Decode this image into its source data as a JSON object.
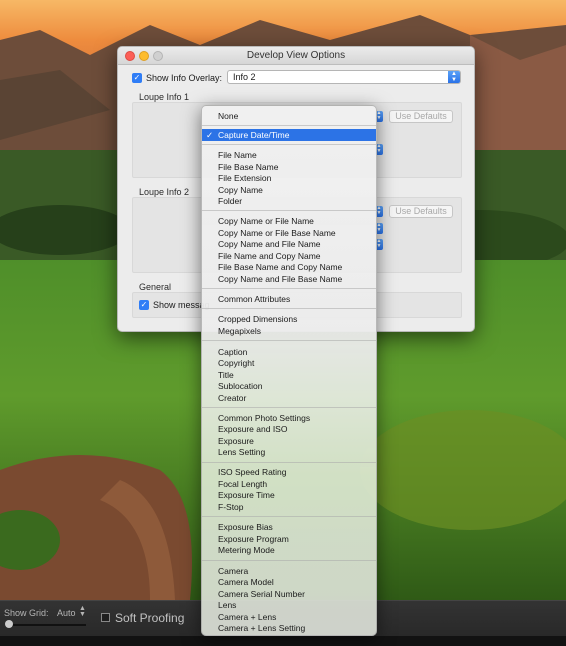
{
  "dialog": {
    "title": "Develop View Options",
    "show_info_overlay_label": "Show Info Overlay:",
    "show_info_overlay_checked": true,
    "overlay_value": "Info 2",
    "loupe_info_1_label": "Loupe Info 1",
    "loupe_info_2_label": "Loupe Info 2",
    "general_label": "General",
    "use_defaults_label": "Use Defaults",
    "show_messages_label": "Show messag",
    "show_messages_checked": true
  },
  "menu": {
    "selected": "Capture Date/Time",
    "check_mark": "✓",
    "items": [
      "None",
      "Capture Date/Time",
      "File Name",
      "File Base Name",
      "File Extension",
      "Copy Name",
      "Folder",
      "Copy Name or File Name",
      "Copy Name or File Base Name",
      "Copy Name and File Name",
      "File Name and Copy Name",
      "File Base Name and Copy Name",
      "Copy Name and File Base Name",
      "Common Attributes",
      "Cropped Dimensions",
      "Megapixels",
      "Caption",
      "Copyright",
      "Title",
      "Sublocation",
      "Creator",
      "Common Photo Settings",
      "Exposure and ISO",
      "Exposure",
      "Lens Setting",
      "ISO Speed Rating",
      "Focal Length",
      "Exposure Time",
      "F-Stop",
      "Exposure Bias",
      "Exposure Program",
      "Metering Mode",
      "Camera",
      "Camera Model",
      "Camera Serial Number",
      "Lens",
      "Camera + Lens",
      "Camera + Lens Setting"
    ]
  },
  "toolbar": {
    "show_grid_label": "Show Grid:",
    "show_grid_value": "Auto",
    "soft_proofing_label": "Soft Proofing",
    "soft_proofing_checked": false
  },
  "colors": {
    "accent": "#2c73e6",
    "checkbox": "#2f7df6",
    "close": "#fc5f57",
    "minimize": "#fdbc2e"
  }
}
